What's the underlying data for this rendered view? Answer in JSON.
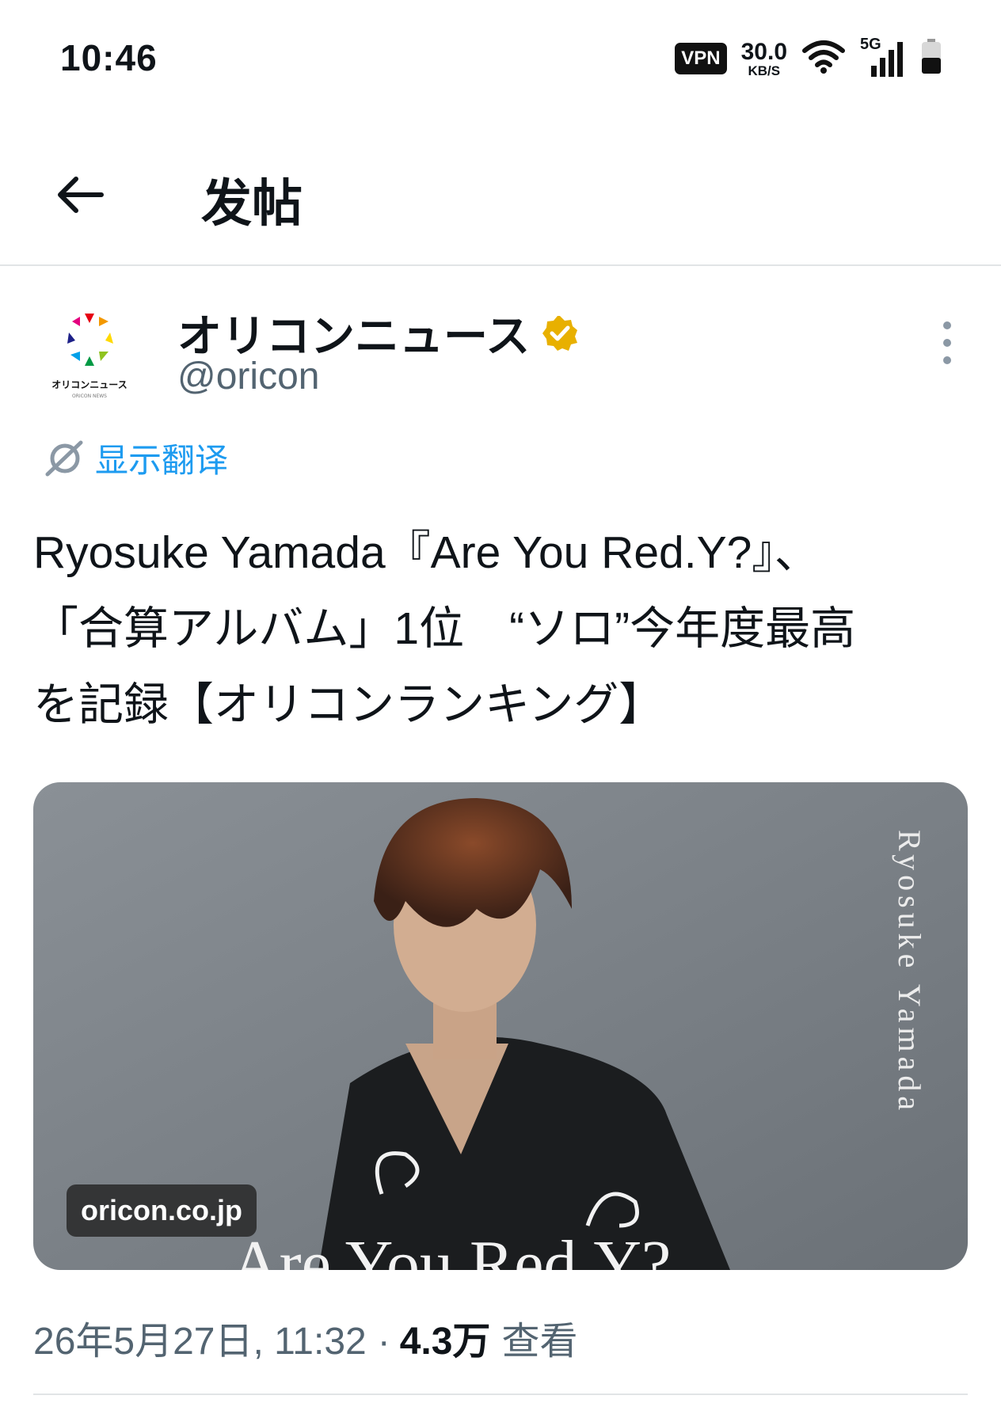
{
  "status_bar": {
    "time": "10:46",
    "vpn": "VPN",
    "speed_value": "30.0",
    "speed_unit": "KB/S",
    "network": "5G",
    "icons": [
      "wifi-icon",
      "signal-icon",
      "battery-icon"
    ]
  },
  "header": {
    "back_icon": "arrow-left-icon",
    "title": "发帖"
  },
  "post": {
    "author": {
      "name": "オリコンニュース",
      "handle": "@oricon",
      "verified": true,
      "avatar_caption": "オリコンニュース",
      "avatar_sub": "ORICON NEWS"
    },
    "translate_label": "显示翻译",
    "text_lines": [
      "Ryosuke Yamada『Are You Red.Y?』、",
      "「合算アルバム」1位　“ソロ”今年度最高",
      "を記録【オリコンランキング】"
    ],
    "media": {
      "domain": "oricon.co.jp",
      "side_title": "Ryosuke Yamada",
      "album_title": "Are You Red.Y?"
    },
    "timestamp": "26年5月27日, 11:32",
    "separator": "·",
    "views": "4.3万",
    "views_label": "查看"
  },
  "colors": {
    "accent": "#1d9bf0",
    "verified_badge": "#e8b000",
    "secondary_text": "#536471"
  }
}
